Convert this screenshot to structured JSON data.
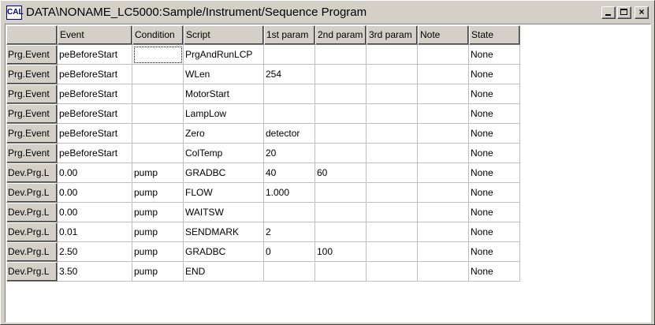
{
  "window": {
    "title": "DATA\\NONAME_LC5000:Sample/Instrument/Sequence Program",
    "icon_name": "calc-app-icon",
    "icon_text": "CAL",
    "min_symbol": "_",
    "max_symbol": "□",
    "close_symbol": "×"
  },
  "grid": {
    "columns": [
      "",
      "Event",
      "Condition",
      "Script",
      "1st param",
      "2nd param",
      "3rd param",
      "Note",
      "State"
    ],
    "rows": [
      [
        "Prg.Event",
        "peBeforeStart",
        "",
        "PrgAndRunLCP",
        "",
        "",
        "",
        "",
        "None"
      ],
      [
        "Prg.Event",
        "peBeforeStart",
        "",
        "WLen",
        "254",
        "",
        "",
        "",
        "None"
      ],
      [
        "Prg.Event",
        "peBeforeStart",
        "",
        "MotorStart",
        "",
        "",
        "",
        "",
        "None"
      ],
      [
        "Prg.Event",
        "peBeforeStart",
        "",
        "LampLow",
        "",
        "",
        "",
        "",
        "None"
      ],
      [
        "Prg.Event",
        "peBeforeStart",
        "",
        "Zero",
        "detector",
        "",
        "",
        "",
        "None"
      ],
      [
        "Prg.Event",
        "peBeforeStart",
        "",
        "ColTemp",
        "20",
        "",
        "",
        "",
        "None"
      ],
      [
        "Dev.Prg.L",
        "0.00",
        "pump",
        "GRADBC",
        "40",
        "60",
        "",
        "",
        "None"
      ],
      [
        "Dev.Prg.L",
        "0.00",
        "pump",
        "FLOW",
        "1.000",
        "",
        "",
        "",
        "None"
      ],
      [
        "Dev.Prg.L",
        "0.00",
        "pump",
        "WAITSW",
        "",
        "",
        "",
        "",
        "None"
      ],
      [
        "Dev.Prg.L",
        "0.01",
        "pump",
        "SENDMARK",
        "2",
        "",
        "",
        "",
        "None"
      ],
      [
        "Dev.Prg.L",
        "2.50",
        "pump",
        "GRADBC",
        "0",
        "100",
        "",
        "",
        "None"
      ],
      [
        "Dev.Prg.L",
        "3.50",
        "pump",
        "END",
        "",
        "",
        "",
        "",
        "None"
      ]
    ]
  }
}
